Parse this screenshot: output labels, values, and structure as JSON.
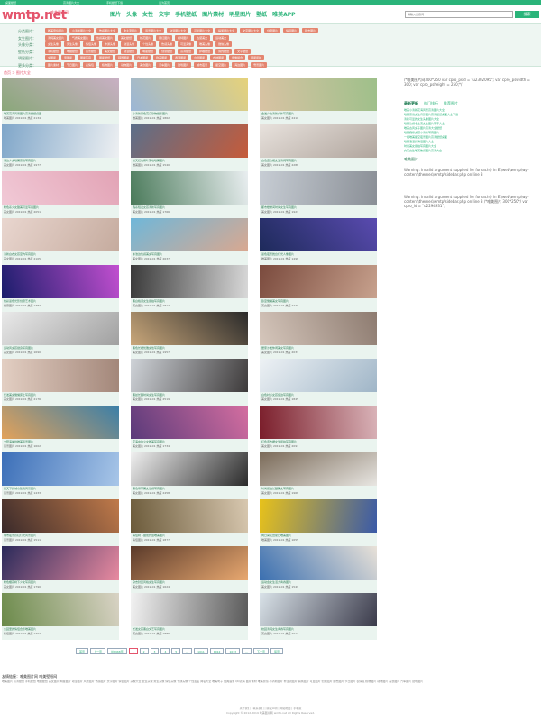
{
  "topbar": {
    "left": "桌面壁纸",
    "center_left": "高清图片大全",
    "center_right": "手机壁纸下载",
    "right": "设为首页"
  },
  "header": {
    "logo": "wmtp.net",
    "logo_sub": "唯美图片网",
    "nav": [
      "图片",
      "头像",
      "女性",
      "文字",
      "手机壁纸",
      "图片素材",
      "明星图片",
      "壁纸",
      "唯美APP"
    ],
    "search_placeholder": "请输入关键词",
    "search_button": "搜索"
  },
  "filters": [
    {
      "label": "分类图片：",
      "tags": [
        "唯美意境图片",
        "小清新图片大全",
        "伤感图片大全",
        "非主流图片",
        "风景图片大全",
        "动漫图片大全",
        "可爱图片大全",
        "搞笑图片大全",
        "文字图片大全",
        "创意图片",
        "情侣图片",
        "励志图片"
      ]
    },
    {
      "label": "女生图片：",
      "tags": [
        "清纯美女图片",
        "气质美女图片",
        "性感美女图片",
        "美女壁纸",
        "校花图片",
        "网红图片",
        "模特图片",
        "古装美女",
        "运动美女"
      ]
    },
    {
      "label": "头像分类：",
      "tags": [
        "女生头像",
        "男生头像",
        "情侣头像",
        "卡通头像",
        "动漫头像",
        "个性头像",
        "伤感头像",
        "可爱头像",
        "唯美头像",
        "微信头像"
      ]
    },
    {
      "label": "壁纸分类：",
      "tags": [
        "手机壁纸",
        "电脑壁纸",
        "风景壁纸",
        "美女壁纸",
        "动漫壁纸",
        "明星壁纸",
        "创意壁纸",
        "高清壁纸",
        "护眼壁纸",
        "简约壁纸",
        "文字壁纸"
      ]
    },
    {
      "label": "明星图片：",
      "tags": [
        "女明星",
        "男明星",
        "明星写真",
        "明星壁纸",
        "韩国明星",
        "日本明星",
        "欧美明星",
        "香港明星",
        "台湾明星",
        "内地明星",
        "偶像组合",
        "明星街拍"
      ]
    },
    {
      "label": "更多分类：",
      "tags": [
        "图片素材",
        "节日图片",
        "表情包",
        "植物图片",
        "动物图片",
        "美食图片",
        "汽车图片",
        "建筑图片",
        "城市夜景",
        "星空图片",
        "海边图片",
        "雪景图片"
      ]
    }
  ],
  "breadcrumb": "首页 > 图片大全",
  "cards": [
    {
      "title": "唯美花海风景图片高清壁纸桌面",
      "meta": "唯美图片  2019-01  热度 2134",
      "c1": "#8aa77a",
      "c2": "#c9b0c4"
    },
    {
      "title": "小清新黄色花朵静物摄影图片",
      "meta": "唯美图片  2019-01  热度 1862",
      "c1": "#9bb6d6",
      "c2": "#e6d27a"
    },
    {
      "title": "金发少女清新户外写真图片",
      "meta": "美女图片  2019-01  热度 2410",
      "c1": "#d9c3a4",
      "c2": "#9ec08a"
    },
    {
      "title": "海边少女唯美意境写真图片",
      "meta": "美女图片  2019-01  热度 1977",
      "c1": "#7fa6c9",
      "c2": "#eef0f2"
    },
    {
      "title": "秋天红色枫叶落地唯美图片",
      "meta": "唯美图片  2019-01  热度 1540",
      "c1": "#5b6f8a",
      "c2": "#c65b3a"
    },
    {
      "title": "白色连衣裙女生清纯写真图片",
      "meta": "美女图片  2019-01  热度 2288",
      "c1": "#e8e2dd",
      "c2": "#b0a59d"
    },
    {
      "title": "粉色系少女甜美可爱写真图片",
      "meta": "美女图片  2019-01  热度 2051",
      "c1": "#f1c9d6",
      "c2": "#e2a3b5"
    },
    {
      "title": "森系短发女孩清新写真图片",
      "meta": "美女图片  2019-01  热度 1766",
      "c1": "#4a7a5a",
      "c2": "#e9eef0"
    },
    {
      "title": "都市楼梯间时尚女生写真图片",
      "meta": "美女图片  2019-01  热度 1923",
      "c1": "#c7cdd4",
      "c2": "#8a8f96"
    },
    {
      "title": "清新白衣女孩室内写真图片",
      "meta": "美女图片  2019-01  热度 2105",
      "c1": "#e9d6cf",
      "c2": "#c5ab9e"
    },
    {
      "title": "泳池边性感美女写真图片",
      "meta": "美女图片  2019-01  热度 2637",
      "c1": "#6fb7d9",
      "c2": "#d9a890"
    },
    {
      "title": "蓝色夜景舞台灯光人像图片",
      "meta": "唯美图片  2019-01  热度 1498",
      "c1": "#1d2a5a",
      "c2": "#5a4bb0"
    },
    {
      "title": "炫彩蓝色光影创意艺术图片",
      "meta": "创意图片  2019-01  热度 1384",
      "c1": "#1a1d6b",
      "c2": "#c24fd0"
    },
    {
      "title": "黑白格调女生街拍写真图片",
      "meta": "美女图片  2019-01  热度 1812",
      "c1": "#3a3a3a",
      "c2": "#d8d8d8"
    },
    {
      "title": "卧室慵懒美女写真图片",
      "meta": "美女图片  2019-01  热度 2240",
      "c1": "#7a4a3d",
      "c2": "#c8a28e"
    },
    {
      "title": "运动风女孩健身写真图片",
      "meta": "美女图片  2019-01  热度 1690",
      "c1": "#e9e9e9",
      "c2": "#a0a0a0"
    },
    {
      "title": "黑色长裙优雅女性写真图片",
      "meta": "美女图片  2019-01  热度 1957",
      "c1": "#c9a77a",
      "c2": "#2a2a2a"
    },
    {
      "title": "居家沙发休闲美女写真图片",
      "meta": "美女图片  2019-01  热度 2033",
      "c1": "#d6c7bc",
      "c2": "#8d7b70"
    },
    {
      "title": "长发美女慵懒床上写真图片",
      "meta": "美女图片  2019-01  热度 2176",
      "c1": "#e3cfc3",
      "c2": "#a3877a"
    },
    {
      "title": "黑丝长腿时尚女生写真图片",
      "meta": "美女图片  2019-01  热度 2519",
      "c1": "#cfd3d8",
      "c2": "#3d3a3a"
    },
    {
      "title": "白色衬衫女孩窗边写真图片",
      "meta": "美女图片  2019-01  热度 1845",
      "c1": "#eef2f5",
      "c2": "#9fb5c7"
    },
    {
      "title": "夕阳海岸线唯美风景图片",
      "meta": "风景图片  2019-01  热度 1602",
      "c1": "#e3a25a",
      "c2": "#3b7fa8"
    },
    {
      "title": "花海中的少女唯美写真图片",
      "meta": "美女图片  2019-01  热度 1734",
      "c1": "#5a3a7a",
      "c2": "#d46ea0"
    },
    {
      "title": "红色连衣裙女生街拍写真图片",
      "meta": "美女图片  2019-01  热度 2091",
      "c1": "#7a1d2a",
      "c2": "#d9b3b8"
    },
    {
      "title": "蓝天下的城市建筑风景图片",
      "meta": "风景图片  2019-01  热度 1433",
      "c1": "#3c6fb8",
      "c2": "#a8c6e8"
    },
    {
      "title": "黑色吊带美女性感写真图片",
      "meta": "美女图片  2019-01  热度 2458",
      "c1": "#f0f0f0",
      "c2": "#2a2a2a"
    },
    {
      "title": "时尚街拍长腿美女写真图片",
      "meta": "美女图片  2019-01  热度 1968",
      "c1": "#7a6a58",
      "c2": "#e8e6e2"
    },
    {
      "title": "城市夜景霓虹灯光风景图片",
      "meta": "风景图片  2019-01  热度 1511",
      "c1": "#3a2a2a",
      "c2": "#c07a4a"
    },
    {
      "title": "情侣树下甜蜜约会唯美图片",
      "meta": "情侣图片  2019-01  热度 1877",
      "c1": "#6b5a3a",
      "c2": "#d8c8b0"
    },
    {
      "title": "向日葵花田夏日唯美图片",
      "meta": "唯美图片  2019-01  热度 1655",
      "c1": "#e8c21a",
      "c2": "#3a5aa8"
    },
    {
      "title": "粉色樱花树下少女写真图片",
      "meta": "美女图片  2019-01  热度 1790",
      "c1": "#2a2a5a",
      "c2": "#e88aa0"
    },
    {
      "title": "杂志封面风格女生写真图片",
      "meta": "美女图片  2019-01  热度 1624",
      "c1": "#5a3a2a",
      "c2": "#e8a870"
    },
    {
      "title": "运动会女生活力青春图片",
      "meta": "美女图片  2019-01  热度 1549",
      "c1": "#3a6fb0",
      "c2": "#e9e2d8"
    },
    {
      "title": "公园里的情侣合影唯美图片",
      "meta": "情侣图片  2019-01  热度 1702",
      "c1": "#6b8a4a",
      "c2": "#d9d3c5"
    },
    {
      "title": "长发女孩黑白文艺写真图片",
      "meta": "美女图片  2019-01  热度 1886",
      "c1": "#f2f2f2",
      "c2": "#5a5a5a"
    },
    {
      "title": "校园清纯女生青春写真图片",
      "meta": "美女图片  2019-01  热度 2013",
      "c1": "#d9e2e8",
      "c2": "#3a3a4a"
    }
  ],
  "sidebar": {
    "code": "/*唯美图片网300*250 var cpro_psid = \"u2302095\"; var cpro_pswidth = 300; var cpro_psheight = 250;*/",
    "tabs": [
      "最新更新",
      "热门排行",
      "推荐图片"
    ],
    "list": [
      "唯美小清新花海风景高清图片大全",
      "唯美意境女生背影图片高清壁纸桌面大全下载",
      "清新可爱的女生头像图片大全",
      "唯美伤感非主流女生图片带字大全",
      "唯美古风女子图片高清大全壁纸",
      "唯美森系女孩小清新写真图片",
      "一组唯美星空夜景图片高清壁纸桌面",
      "唯美浪漫的情侣图片大全",
      "时尚美女街拍写真图片大全",
      "文艺女生唯美伤感图片高清大全"
    ],
    "section_title": "唯美图片",
    "warning1": "Warning: Invalid argument supplied for foreach() in E:\\web\\wmtp\\wp-content\\themes\\wmtp\\sidebar.php on line 3",
    "warning2": "Warning: Invalid argument supplied for foreach() in E:\\web\\wmtp\\wp-content\\themes\\wmtp\\sidebar.php on line 3 /*唯美图片 300*250*/ var cpro_id = \"u2294931\";"
  },
  "pager": {
    "items": [
      "首页",
      "上一页",
      "共6968页",
      "1",
      "2",
      "3",
      "4",
      "5",
      "...",
      "1011",
      "1012",
      "1013",
      "...",
      "下一页",
      "尾页"
    ],
    "current": "1"
  },
  "footer": {
    "links_title": "友情链接：唯美图片网 唯美壁纸网",
    "links": "唯美图片 高清壁纸 手机壁纸 电脑壁纸 美女图片 明星图片 动漫图片 风景图片 伤感图片 文字图片 情侣图片 头像大全 女生头像 男生头像 情侣头像 卡通头像 个性签名 网名大全 唯美句子 经典语录 QQ表情 图片素材 唯美意境 小清新图片 非主流图片 搞笑图片 可爱图片 创意图片 励志图片 节日图片 表情包 植物图片 动物图片 美食图片 汽车图片 建筑图片",
    "line1": "关于我们 | 联系我们 | 版权声明 | 网站地图 | 手机版",
    "line2": "Copyright © 2012-2019 唯美图片网 wmtp.net All Rights Reserved."
  },
  "colors": {
    "accent": "#2bb47a",
    "brand": "#e4546c",
    "tag": "#e4856f"
  }
}
